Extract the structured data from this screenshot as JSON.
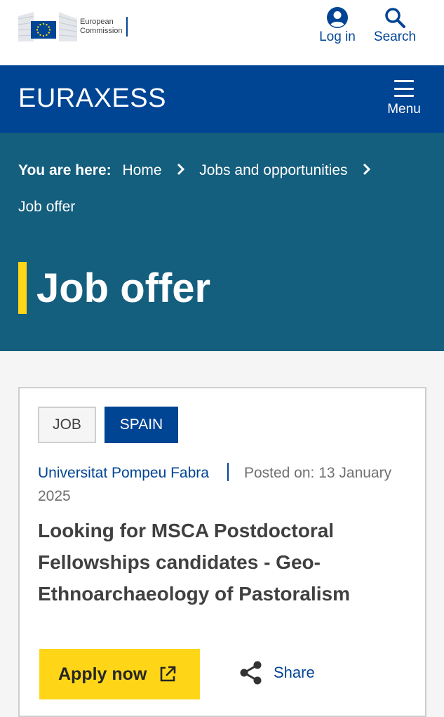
{
  "topbar": {
    "logo_line1": "European",
    "logo_line2": "Commission",
    "login_label": "Log in",
    "search_label": "Search"
  },
  "header": {
    "site_name": "EURAXESS",
    "menu_label": "Menu"
  },
  "breadcrumb": {
    "label": "You are here:",
    "items": [
      "Home",
      "Jobs and opportunities",
      "Job offer"
    ]
  },
  "page": {
    "title": "Job offer"
  },
  "job": {
    "tags": [
      "JOB",
      "SPAIN"
    ],
    "organisation": "Universitat Pompeu Fabra",
    "posted": "Posted on: 13 January 2025",
    "title": "Looking for MSCA Postdoctoral Fellowships candidates - Geo-Ethnoarchaeology of Pastoralism",
    "apply_label": "Apply now",
    "share_label": "Share"
  },
  "colors": {
    "eu_blue": "#004494",
    "teal": "#145e7e",
    "accent_yellow": "#ffd617"
  }
}
